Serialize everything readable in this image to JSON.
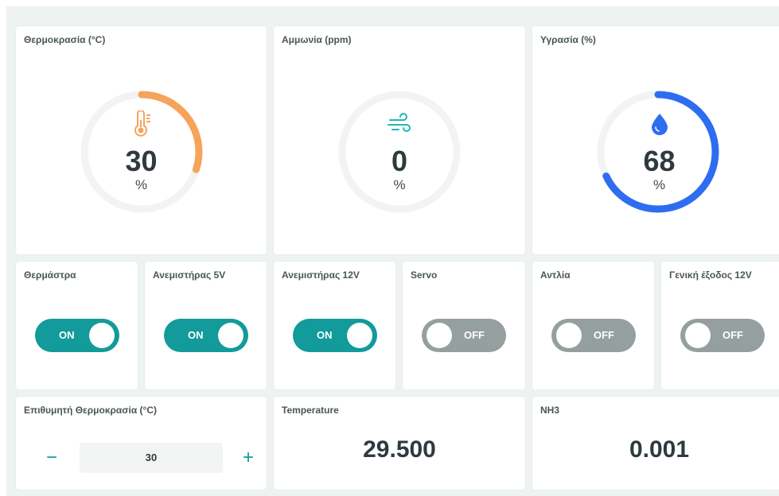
{
  "gauges": [
    {
      "title": "Θερμοκρασία (°C)",
      "value": "30",
      "unit": "%",
      "level": 0.3,
      "color": "#f7a35c",
      "icon": "thermometer-icon"
    },
    {
      "title": "Αμμωνία (ppm)",
      "value": "0",
      "unit": "%",
      "level": 0.0,
      "color": "#23b5b5",
      "icon": "wind-icon"
    },
    {
      "title": "Υγρασία (%)",
      "value": "68",
      "unit": "%",
      "level": 0.68,
      "color": "#2f6df0",
      "icon": "droplet-icon"
    }
  ],
  "switches": [
    {
      "title": "Θερμάστρα",
      "state": "ON"
    },
    {
      "title": "Ανεμιστήρας 5V",
      "state": "ON"
    },
    {
      "title": "Ανεμιστήρας 12V",
      "state": "ON"
    },
    {
      "title": "Servo",
      "state": "OFF"
    },
    {
      "title": "Αντλία",
      "state": "OFF"
    },
    {
      "title": "Γενική έξοδος 12V",
      "state": "OFF"
    }
  ],
  "stepper": {
    "title": "Επιθυμητή Θερμοκρασία (°C)",
    "value": "30",
    "minus": "−",
    "plus": "+"
  },
  "values": [
    {
      "title": "Temperature",
      "value": "29.500"
    },
    {
      "title": "NH3",
      "value": "0.001"
    }
  ],
  "colors": {
    "accent": "#139a9a",
    "off": "#969f9f",
    "track": "#f3f3f3"
  }
}
